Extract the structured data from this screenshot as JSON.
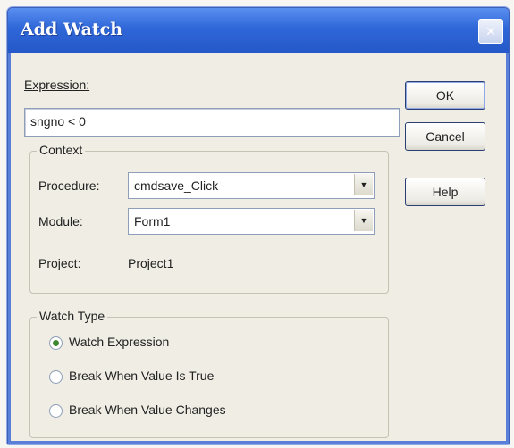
{
  "window": {
    "title": "Add Watch"
  },
  "expression": {
    "label": "Expression:",
    "value": "sngno < 0"
  },
  "context": {
    "title": "Context",
    "procedure_label": "Procedure:",
    "procedure_value": "cmdsave_Click",
    "module_label": "Module:",
    "module_value": "Form1",
    "project_label": "Project:",
    "project_value": "Project1"
  },
  "watch_type": {
    "title": "Watch Type",
    "options": [
      {
        "label": "Watch Expression",
        "selected": true
      },
      {
        "label": "Break When Value Is True",
        "selected": false
      },
      {
        "label": "Break When Value Changes",
        "selected": false
      }
    ]
  },
  "buttons": {
    "ok": "OK",
    "cancel": "Cancel",
    "help": "Help"
  },
  "colors": {
    "titlebar": "#2f67d8",
    "face": "#efede4",
    "radio_dot": "#3d8a2e"
  }
}
